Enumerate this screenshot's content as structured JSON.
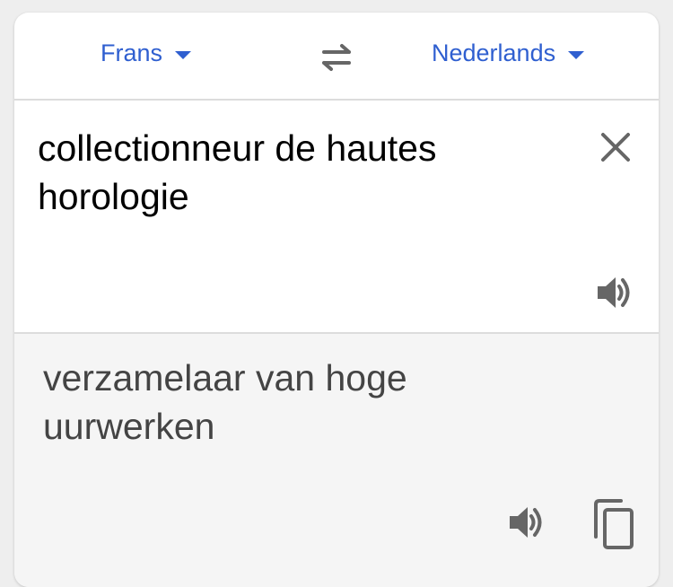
{
  "header": {
    "source_language": "Frans",
    "target_language": "Nederlands"
  },
  "source": {
    "text": "collectionneur de hautes horologie"
  },
  "translation": {
    "text": "verzamelaar van hoge uurwerken"
  },
  "colors": {
    "accent": "#2f5fd0",
    "icon": "#666666",
    "translation_bg": "#f5f5f5"
  },
  "icons": {
    "caret": "chevron-down-icon",
    "swap": "swap-icon",
    "clear": "close-icon",
    "speaker": "speaker-icon",
    "copy": "copy-icon"
  }
}
